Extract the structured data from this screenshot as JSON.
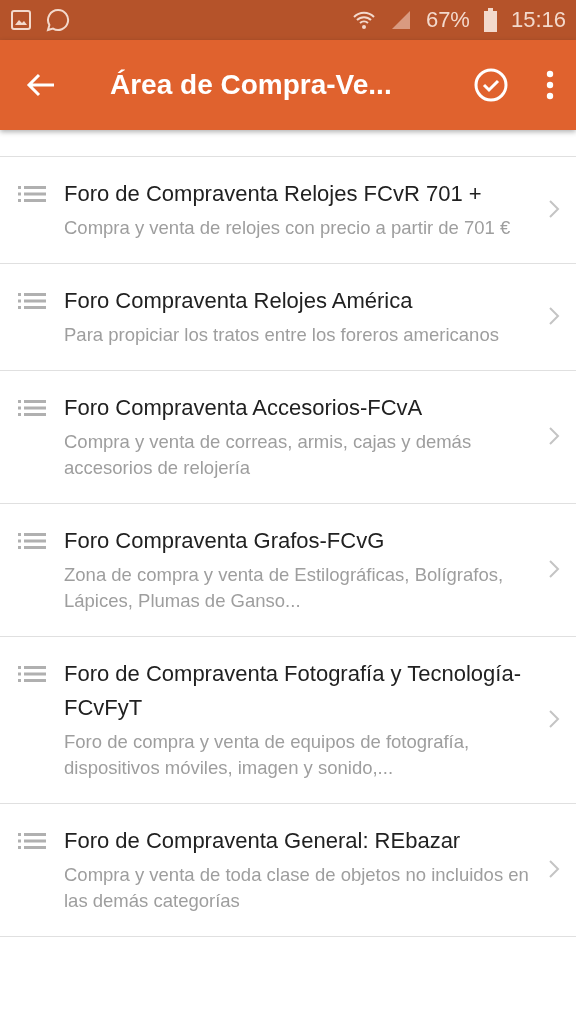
{
  "status_bar": {
    "battery": "67%",
    "time": "15:16"
  },
  "app_bar": {
    "title": "Área de Compra-Ve..."
  },
  "forums": [
    {
      "title": "Foro de Compraventa Relojes FCvR 701 +",
      "description": "Compra y venta de relojes con precio a partir de 701 €"
    },
    {
      "title": "Foro Compraventa Relojes América",
      "description": "Para propiciar los tratos entre los foreros americanos"
    },
    {
      "title": "Foro Compraventa Accesorios-FCvA",
      "description": "Compra y venta de correas, armis, cajas y demás accesorios de relojería"
    },
    {
      "title": "Foro Compraventa Grafos-FCvG",
      "description": "Zona de compra y venta de Estilográficas, Bolígrafos, Lápices, Plumas de Ganso..."
    },
    {
      "title": "Foro de Compraventa Fotografía y Tecnología-FCvFyT",
      "description": "Foro de compra y venta de equipos de fotografía, dispositivos móviles, imagen y sonido,..."
    },
    {
      "title": "Foro de Compraventa General: REbazar",
      "description": "Compra y venta de toda clase de objetos no incluidos en las demás categorías"
    }
  ]
}
